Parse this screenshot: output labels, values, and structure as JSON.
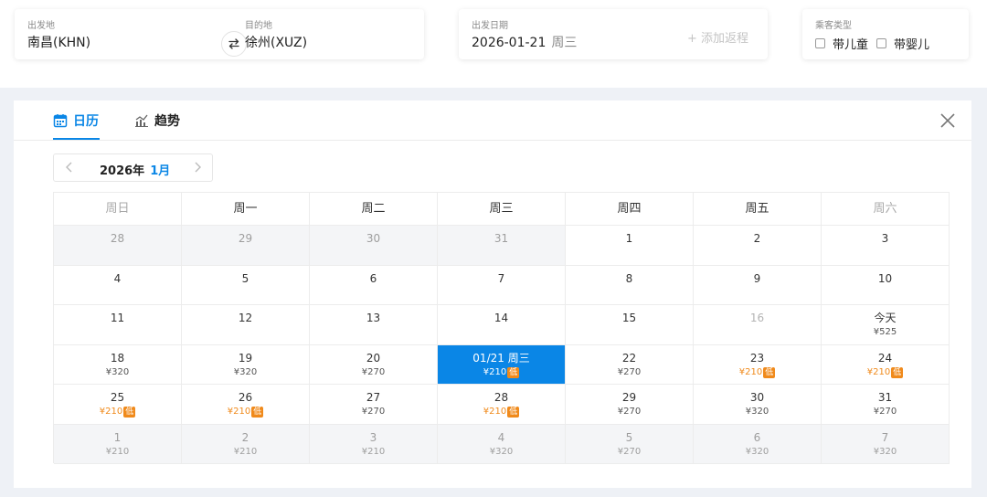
{
  "search": {
    "from": {
      "label": "出发地",
      "value": "南昌(KHN)"
    },
    "to": {
      "label": "目的地",
      "value": "徐州(XUZ)"
    },
    "date": {
      "label": "出发日期",
      "value": "2026-01-21",
      "weekday": "周三"
    },
    "add_trip": "+ 添加返程",
    "passenger": {
      "label": "乘客类型",
      "child": "带儿童",
      "infant": "带婴儿"
    }
  },
  "panel": {
    "tabs": {
      "calendar": "日历",
      "trend": "趋势"
    },
    "year": "2026年",
    "month": "1月",
    "weekdays": [
      "周日",
      "周一",
      "周二",
      "周三",
      "周四",
      "周五",
      "周六"
    ],
    "low_tag": "低",
    "weeks": [
      [
        {
          "day": "28",
          "price": "",
          "grey": true
        },
        {
          "day": "29",
          "price": "",
          "grey": true
        },
        {
          "day": "30",
          "price": "",
          "grey": true
        },
        {
          "day": "31",
          "price": "",
          "grey": true
        },
        {
          "day": "1",
          "price": ""
        },
        {
          "day": "2",
          "price": ""
        },
        {
          "day": "3",
          "price": ""
        }
      ],
      [
        {
          "day": "4",
          "price": ""
        },
        {
          "day": "5",
          "price": ""
        },
        {
          "day": "6",
          "price": ""
        },
        {
          "day": "7",
          "price": ""
        },
        {
          "day": "8",
          "price": ""
        },
        {
          "day": "9",
          "price": ""
        },
        {
          "day": "10",
          "price": ""
        }
      ],
      [
        {
          "day": "11",
          "price": ""
        },
        {
          "day": "12",
          "price": ""
        },
        {
          "day": "13",
          "price": ""
        },
        {
          "day": "14",
          "price": ""
        },
        {
          "day": "15",
          "price": ""
        },
        {
          "day": "16",
          "price": "",
          "muted": true
        },
        {
          "day": "今天",
          "price": "¥525"
        }
      ],
      [
        {
          "day": "18",
          "price": "¥320"
        },
        {
          "day": "19",
          "price": "¥320"
        },
        {
          "day": "20",
          "price": "¥270"
        },
        {
          "day": "01/21 周三",
          "price": "¥210",
          "low": true,
          "selected": true
        },
        {
          "day": "22",
          "price": "¥270"
        },
        {
          "day": "23",
          "price": "¥210",
          "low": true
        },
        {
          "day": "24",
          "price": "¥210",
          "low": true
        }
      ],
      [
        {
          "day": "25",
          "price": "¥210",
          "low": true
        },
        {
          "day": "26",
          "price": "¥210",
          "low": true
        },
        {
          "day": "27",
          "price": "¥270"
        },
        {
          "day": "28",
          "price": "¥210",
          "low": true
        },
        {
          "day": "29",
          "price": "¥270"
        },
        {
          "day": "30",
          "price": "¥320"
        },
        {
          "day": "31",
          "price": "¥270"
        }
      ],
      [
        {
          "day": "1",
          "price": "¥210",
          "grey": true
        },
        {
          "day": "2",
          "price": "¥210",
          "grey": true
        },
        {
          "day": "3",
          "price": "¥210",
          "grey": true
        },
        {
          "day": "4",
          "price": "¥320",
          "grey": true
        },
        {
          "day": "5",
          "price": "¥270",
          "grey": true
        },
        {
          "day": "6",
          "price": "¥320",
          "grey": true
        },
        {
          "day": "7",
          "price": "¥320",
          "grey": true
        }
      ]
    ]
  },
  "colors": {
    "accent": "#0a86e6",
    "low": "#f08a1b"
  }
}
